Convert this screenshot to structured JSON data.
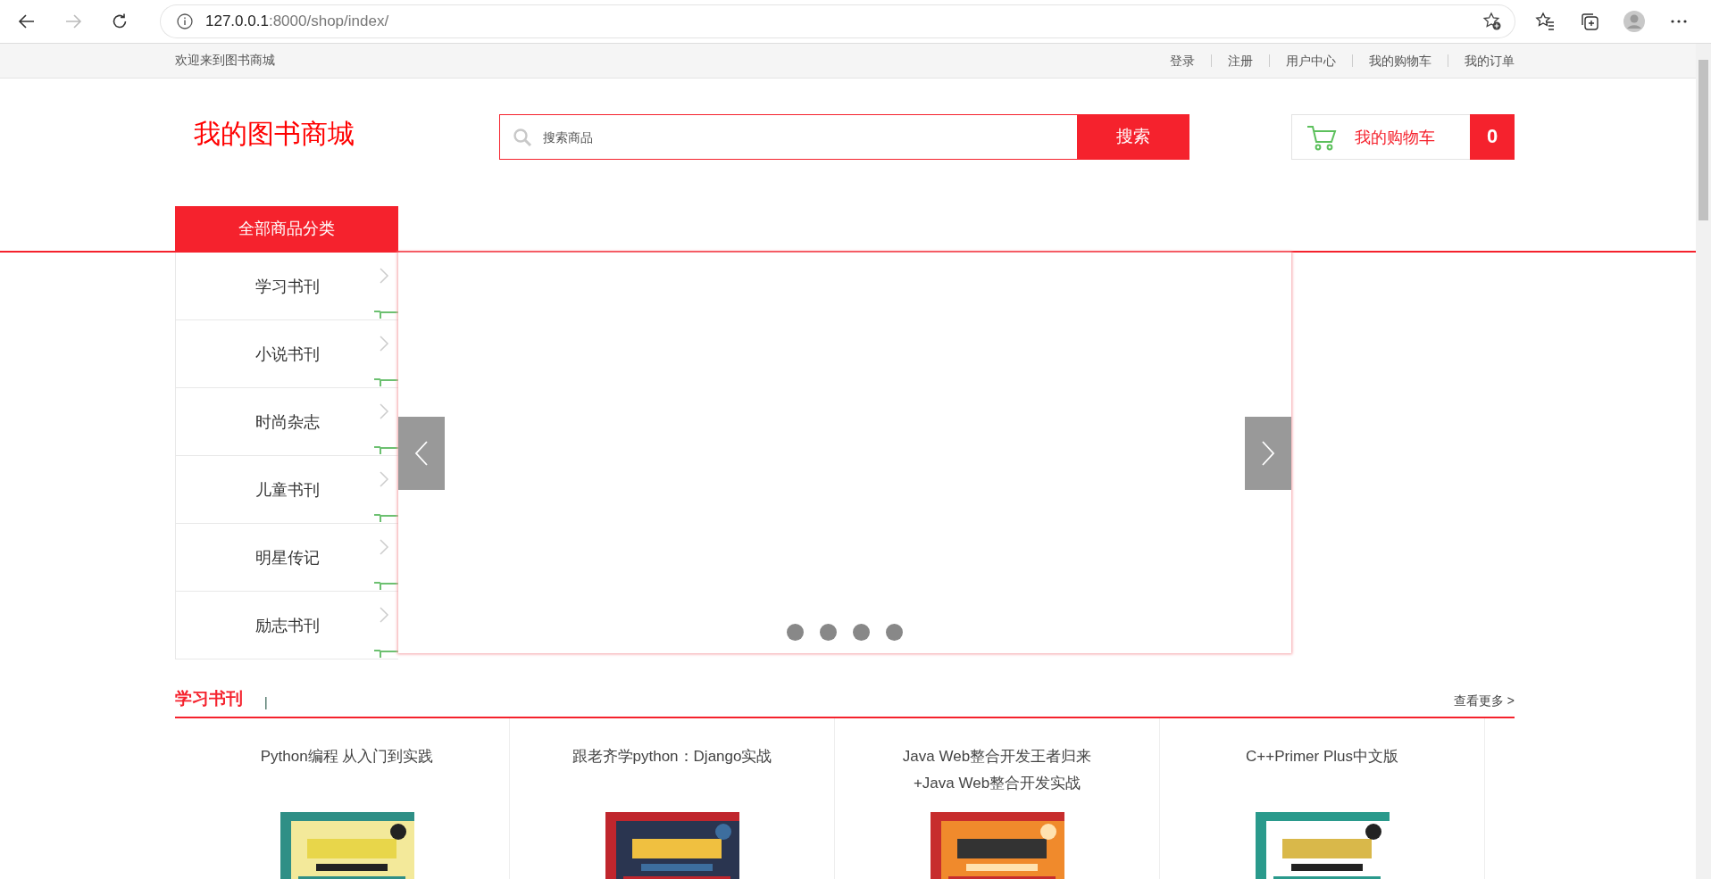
{
  "browser": {
    "url_host": "127.0.0.1",
    "url_path": ":8000/shop/index/"
  },
  "top_bar": {
    "welcome": "欢迎来到图书商城",
    "links": [
      "登录",
      "注册",
      "用户中心",
      "我的购物车",
      "我的订单"
    ]
  },
  "header": {
    "logo": "我的图书商城",
    "search": {
      "placeholder": "搜索商品",
      "button": "搜索"
    },
    "cart": {
      "label": "我的购物车",
      "count": "0"
    }
  },
  "nav": {
    "category_tab": "全部商品分类"
  },
  "sidebar": {
    "items": [
      "学习书刊",
      "小说书刊",
      "时尚杂志",
      "儿童书刊",
      "明星传记",
      "励志书刊"
    ]
  },
  "section": {
    "title": "学习书刊",
    "divider": "|",
    "more": "查看更多 >",
    "books": [
      {
        "title": "Python编程 从入门到实践"
      },
      {
        "title": "跟老齐学python：Django实战"
      },
      {
        "title": "Java Web整合开发王者归来\n+Java Web整合开发实战"
      },
      {
        "title": "C++Primer Plus中文版"
      }
    ]
  }
}
